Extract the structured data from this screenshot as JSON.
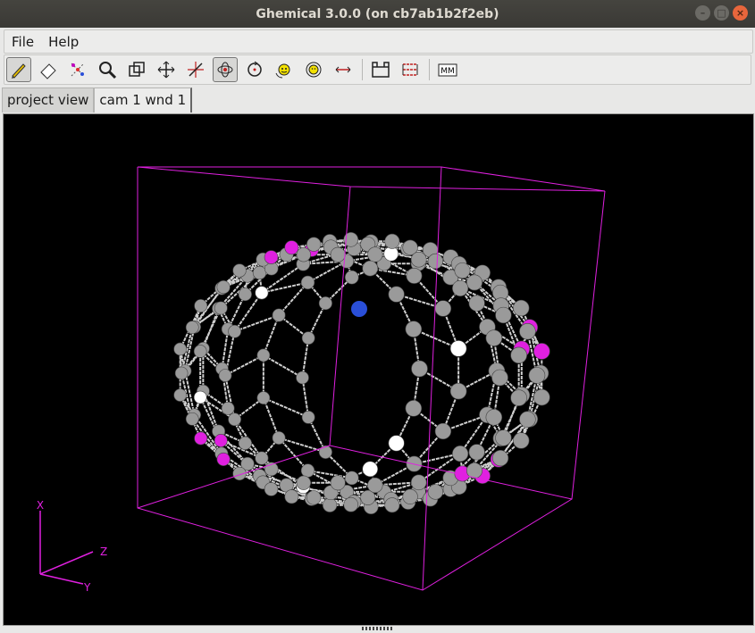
{
  "window": {
    "title": "Ghemical 3.0.0 (on cb7ab1b2f2eb)"
  },
  "menu": {
    "file": "File",
    "help": "Help"
  },
  "toolbar": [
    {
      "icon": "pencil-draw-icon"
    },
    {
      "icon": "eraser-icon"
    },
    {
      "icon": "select-atoms-icon"
    },
    {
      "icon": "zoom-icon"
    },
    {
      "icon": "clipping-icon"
    },
    {
      "icon": "translate-xy-icon"
    },
    {
      "icon": "translate-z-icon"
    },
    {
      "icon": "orbit-xy-icon"
    },
    {
      "icon": "orbit-z-icon"
    },
    {
      "icon": "rotate-xy-icon"
    },
    {
      "icon": "rotate-z-icon"
    },
    {
      "icon": "measure-icon"
    },
    {
      "icon": "element-table-icon"
    },
    {
      "icon": "bond-type-icon"
    },
    {
      "icon": "mm-setup-icon",
      "label": "MM"
    }
  ],
  "tabs": {
    "project": "project view",
    "camera": "cam 1 wnd 1"
  },
  "axes": {
    "x": "X",
    "y": "Y",
    "z": "Z"
  },
  "colors": {
    "carbon": "#9a9a9a",
    "hydrogen": "#ffffff",
    "nitrogen": "#2a4fd8",
    "selected": "#e020e0",
    "box": "#e020e0",
    "background": "#000000"
  }
}
